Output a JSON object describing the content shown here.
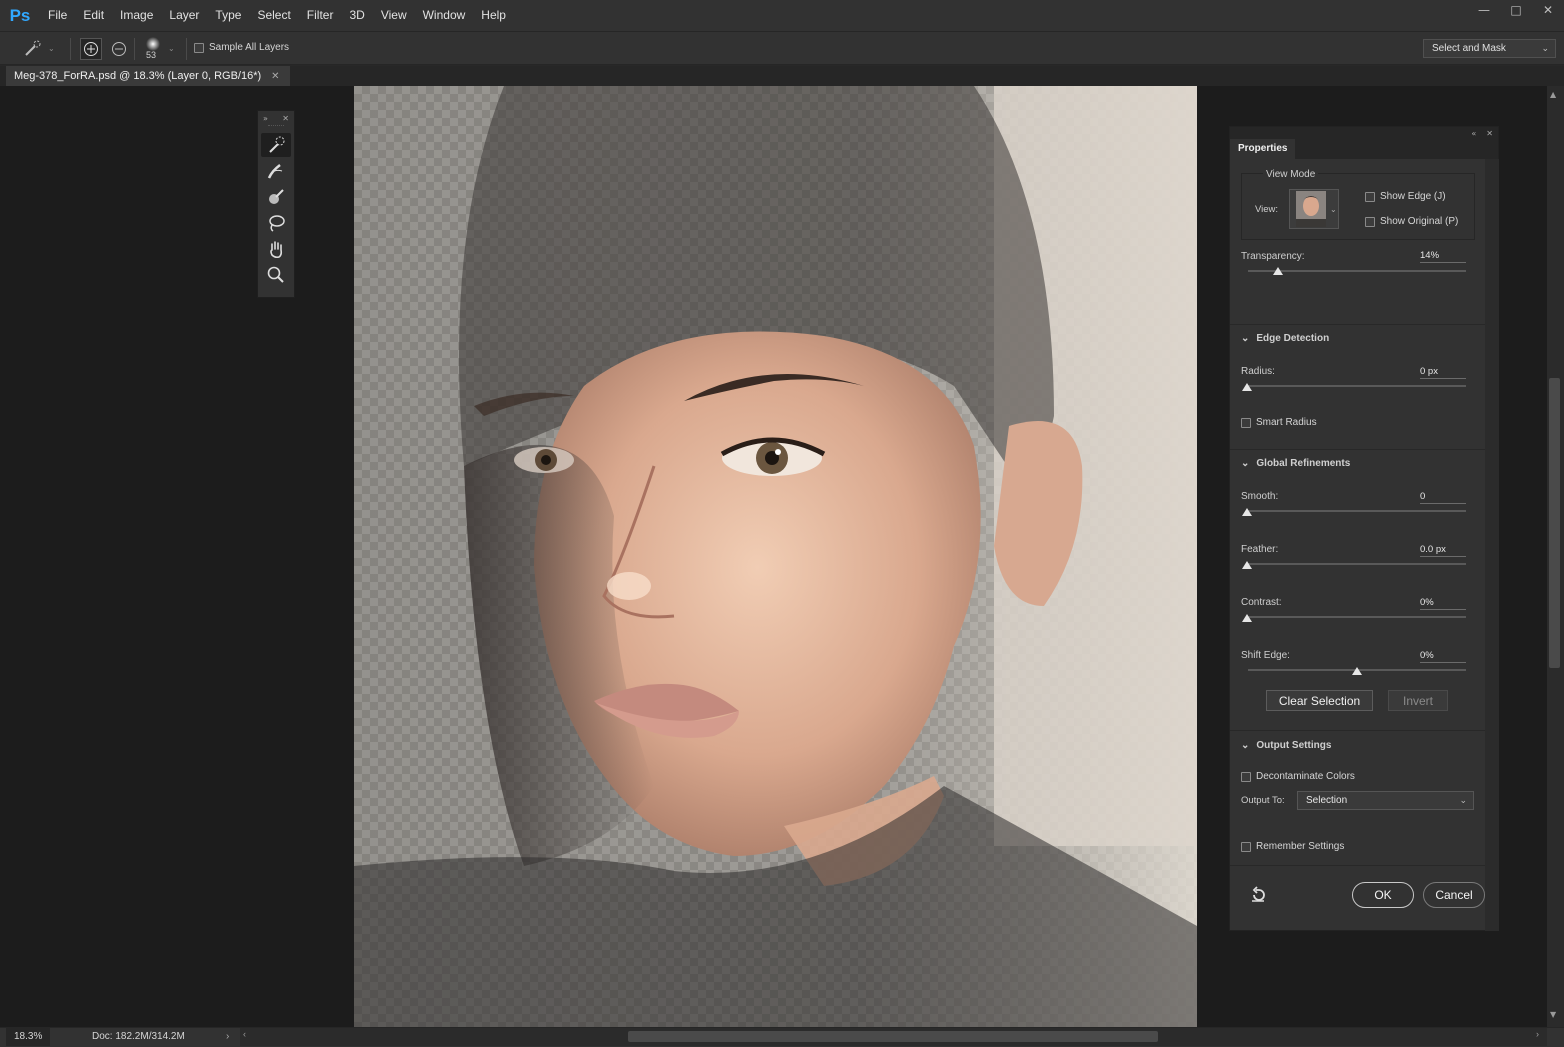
{
  "app": {
    "logo": "Ps"
  },
  "menu": [
    "File",
    "Edit",
    "Image",
    "Layer",
    "Type",
    "Select",
    "Filter",
    "3D",
    "View",
    "Window",
    "Help"
  ],
  "options": {
    "brush_size": "53",
    "sample_all_layers": "Sample All Layers",
    "select_and_mask": "Select and Mask"
  },
  "document": {
    "tab_title": "Meg-378_ForRA.psd @ 18.3% (Layer 0, RGB/16*)"
  },
  "properties": {
    "tab": "Properties",
    "view_mode": {
      "heading": "View Mode",
      "view_label": "View:",
      "show_edge": "Show Edge (J)",
      "show_original": "Show Original (P)"
    },
    "transparency": {
      "label": "Transparency:",
      "value": "14%",
      "fraction": 0.14
    },
    "edge_detection": {
      "heading": "Edge Detection",
      "radius_label": "Radius:",
      "radius_value": "0 px",
      "smart_radius": "Smart Radius"
    },
    "global_refinements": {
      "heading": "Global Refinements",
      "smooth_label": "Smooth:",
      "smooth_value": "0",
      "feather_label": "Feather:",
      "feather_value": "0.0 px",
      "contrast_label": "Contrast:",
      "contrast_value": "0%",
      "shift_edge_label": "Shift Edge:",
      "shift_edge_value": "0%"
    },
    "buttons": {
      "clear_selection": "Clear Selection",
      "invert": "Invert"
    },
    "output_settings": {
      "heading": "Output Settings",
      "decontaminate": "Decontaminate Colors",
      "output_to_label": "Output To:",
      "output_to_value": "Selection"
    },
    "remember_settings": "Remember Settings",
    "ok": "OK",
    "cancel": "Cancel"
  },
  "status": {
    "zoom": "18.3%",
    "doc": "Doc: 182.2M/314.2M"
  },
  "colors": {
    "accent": "#31a8ff",
    "panel": "#323232",
    "workspace": "#1c1c1c"
  }
}
